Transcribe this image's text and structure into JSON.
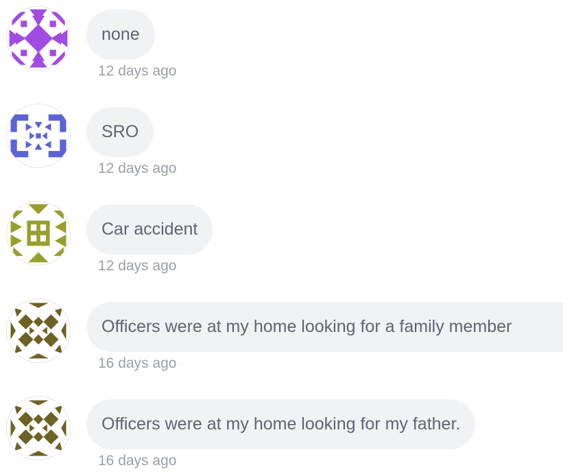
{
  "comments": [
    {
      "avatar_icon": "purple-identicon-avatar-icon",
      "avatar_color": "#a24be3",
      "text": "none",
      "time": "12 days ago"
    },
    {
      "avatar_icon": "blue-identicon-avatar-icon",
      "avatar_color": "#5b63d6",
      "text": "SRO",
      "time": "12 days ago"
    },
    {
      "avatar_icon": "olive-identicon-avatar-icon",
      "avatar_color": "#97a02e",
      "text": "Car accident",
      "time": "12 days ago"
    },
    {
      "avatar_icon": "dark-olive-identicon-avatar-icon",
      "avatar_color": "#6d6224",
      "text": "Officers were at my home looking for a family member",
      "time": "16 days ago"
    },
    {
      "avatar_icon": "dark-olive-identicon-avatar-icon",
      "avatar_color": "#6d6224",
      "text": "Officers were at my home looking for my father.",
      "time": "16 days ago"
    }
  ]
}
